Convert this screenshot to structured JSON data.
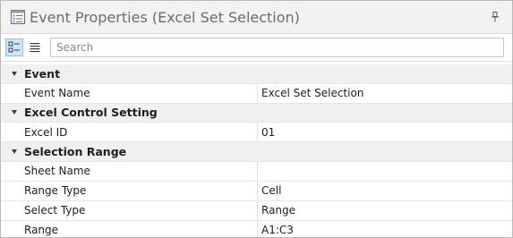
{
  "window": {
    "title": "Event Properties (Excel Set Selection)",
    "icon": "properties-window-icon",
    "pin_icon": "pin-icon"
  },
  "toolbar": {
    "categorized_icon": "categorized-view-icon",
    "alphabetical_icon": "alphabetical-view-icon",
    "search_placeholder": "Search",
    "search_value": ""
  },
  "categories": [
    {
      "label": "Event",
      "properties": [
        {
          "name": "Event Name",
          "value": "Excel Set Selection"
        }
      ]
    },
    {
      "label": "Excel Control Setting",
      "properties": [
        {
          "name": "Excel ID",
          "value": "01"
        }
      ]
    },
    {
      "label": "Selection Range",
      "properties": [
        {
          "name": "Sheet Name",
          "value": ""
        },
        {
          "name": "Range Type",
          "value": "Cell"
        },
        {
          "name": "Select Type",
          "value": "Range"
        },
        {
          "name": "Range",
          "value": "A1:C3"
        }
      ]
    }
  ],
  "colors": {
    "titlebar_bg": "#f2f2f2",
    "category_bg": "#f0f0f0",
    "active_button_bg": "#cde6f7",
    "active_button_border": "#92c0e0"
  }
}
